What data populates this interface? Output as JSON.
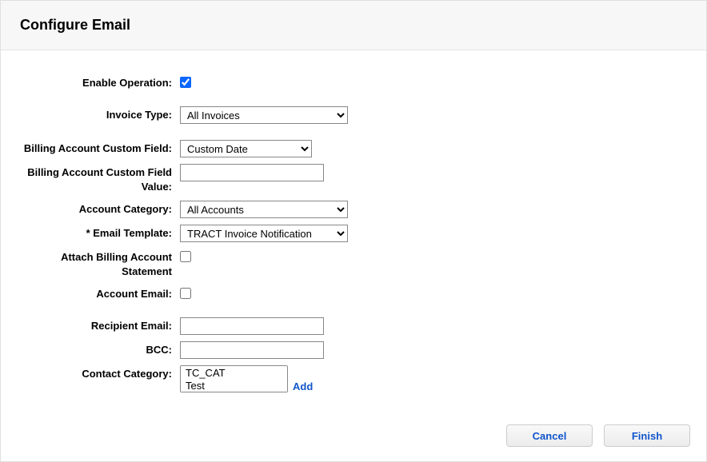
{
  "header": {
    "title": "Configure Email"
  },
  "labels": {
    "enable_operation": "Enable Operation:",
    "invoice_type": "Invoice Type:",
    "billing_account_cf": "Billing Account Custom Field:",
    "billing_account_cfv": "Billing Account Custom Field Value:",
    "account_category": "Account Category:",
    "email_template": "* Email Template:",
    "attach_stmt": "Attach Billing Account Statement",
    "account_email": "Account Email:",
    "recipient_email": "Recipient Email:",
    "bcc": "BCC:",
    "contact_category": "Contact Category:"
  },
  "fields": {
    "enable_operation_checked": true,
    "invoice_type_value": "All Invoices",
    "billing_account_cf_value": "Custom Date",
    "billing_account_cfv_value": "",
    "account_category_value": "All Accounts",
    "email_template_value": "TRACT Invoice Notification",
    "attach_stmt_checked": false,
    "account_email_checked": false,
    "recipient_email_value": "",
    "bcc_value": "",
    "contact_category_options": [
      "TC_CAT",
      "Test"
    ]
  },
  "links": {
    "add": "Add"
  },
  "buttons": {
    "cancel": "Cancel",
    "finish": "Finish"
  }
}
